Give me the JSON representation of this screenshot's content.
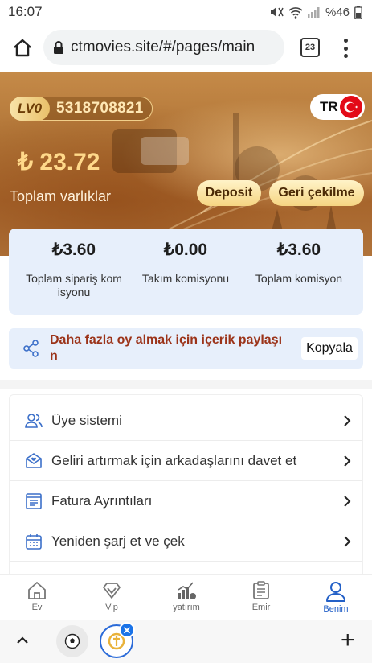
{
  "status_bar": {
    "time": "16:07",
    "battery": "%46"
  },
  "browser": {
    "url": "ctmovies.site/#/pages/main",
    "tab_count": "23"
  },
  "hero": {
    "level": "LV0",
    "user_id": "5318708821",
    "lang": "TR",
    "balance": "₺ 23.72",
    "balance_label": "Toplam varlıklar",
    "deposit_label": "Deposit",
    "withdraw_label": "Geri çekilme"
  },
  "commission": {
    "stats": [
      {
        "value": "₺3.60",
        "label": "Toplam sipariş kom isyonu"
      },
      {
        "value": "₺0.00",
        "label": "Takım komisyonu"
      },
      {
        "value": "₺3.60",
        "label": "Toplam komisyon"
      }
    ]
  },
  "share": {
    "text": "Daha fazla oy almak için içerik paylaşı n",
    "copy_label": "Kopyala"
  },
  "menu": {
    "items": [
      {
        "label": "Üye sistemi",
        "icon": "members-icon"
      },
      {
        "label": "Geliri artırmak için arkadaşlarını davet et",
        "icon": "invite-icon"
      },
      {
        "label": "Fatura Ayrıntıları",
        "icon": "invoice-icon"
      },
      {
        "label": "Yeniden şarj et ve çek",
        "icon": "calendar-icon"
      }
    ]
  },
  "bottom_nav": {
    "items": [
      {
        "label": "Ev",
        "icon": "home-icon"
      },
      {
        "label": "Vip",
        "icon": "diamond-icon"
      },
      {
        "label": "yatırım",
        "icon": "chart-icon"
      },
      {
        "label": "Emir",
        "icon": "order-icon"
      },
      {
        "label": "Benim",
        "icon": "profile-icon"
      }
    ],
    "active": "Benim"
  },
  "colors": {
    "accent_blue": "#2360c7",
    "gold": "#f6d582",
    "card_bg": "#e7effb",
    "share_text": "#9b3319"
  }
}
